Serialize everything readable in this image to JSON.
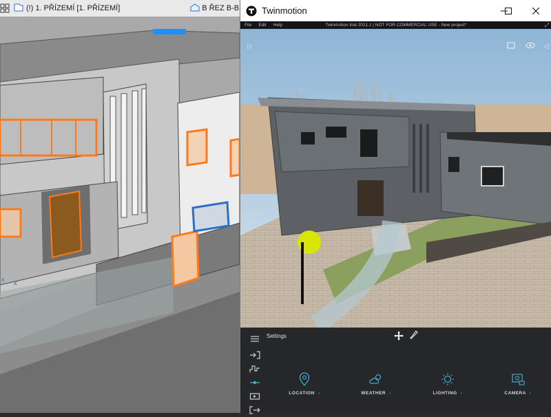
{
  "archicad": {
    "tabs": [
      {
        "label": "(!) 1. PŘÍZEMÍ [1. PŘÍZEMÍ]"
      },
      {
        "label": "B ŘEZ B-B [B ŘEZ"
      }
    ]
  },
  "twinmotion": {
    "window_title": "Twinmotion",
    "menu": [
      "File",
      "Edit",
      "Help"
    ],
    "subtitle": "Twinmotion trial 2021.1 | NOT FOR COMMERCIAL USE - New project*",
    "panel": {
      "settings_label": "Settings",
      "categories": [
        {
          "label": "LOCATION",
          "icon": "location-pin-icon"
        },
        {
          "label": "WEATHER",
          "icon": "weather-icon"
        },
        {
          "label": "LIGHTING",
          "icon": "lighting-icon"
        },
        {
          "label": "CAMERA",
          "icon": "camera-icon"
        }
      ],
      "rail_icons": [
        "import-icon",
        "context-icon",
        "settings-sliders-icon",
        "media-icon",
        "export-icon"
      ]
    }
  },
  "colors": {
    "accent": "#3bb0c9",
    "selection": "#ff7a1a"
  }
}
